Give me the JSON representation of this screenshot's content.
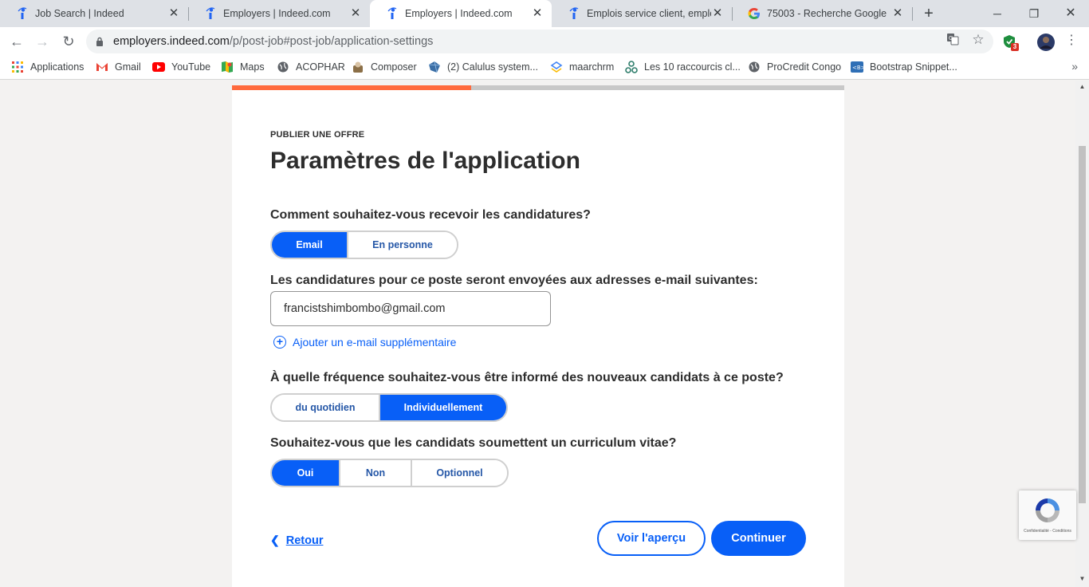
{
  "browser": {
    "tabs": [
      {
        "title": "Job Search | Indeed",
        "icon": "indeed-icon",
        "active": false
      },
      {
        "title": "Employers | Indeed.com",
        "icon": "indeed-icon",
        "active": false
      },
      {
        "title": "Employers | Indeed.com",
        "icon": "indeed-icon",
        "active": true
      },
      {
        "title": "Emplois service client, emploi |",
        "icon": "indeed-icon",
        "active": false
      },
      {
        "title": "75003 - Recherche Google",
        "icon": "google-icon",
        "active": false
      }
    ],
    "url_host": "employers.indeed.com",
    "url_path": "/p/post-job#post-job/application-settings",
    "extension_badge": "3",
    "bookmarks": [
      {
        "label": "Applications",
        "icon": "apps-grid-icon"
      },
      {
        "label": "Gmail",
        "icon": "gmail-icon"
      },
      {
        "label": "YouTube",
        "icon": "youtube-icon"
      },
      {
        "label": "Maps",
        "icon": "maps-icon"
      },
      {
        "label": "ACOPHAR",
        "icon": "globe-icon"
      },
      {
        "label": "Composer",
        "icon": "composer-icon"
      },
      {
        "label": "(2) Calulus system...",
        "icon": "calulus-icon"
      },
      {
        "label": "maarchrm",
        "icon": "maarch-icon"
      },
      {
        "label": "Les 10 raccourcis cl...",
        "icon": "raccourcis-icon"
      },
      {
        "label": "ProCredit Congo",
        "icon": "globe-icon"
      },
      {
        "label": "Bootstrap Snippet...",
        "icon": "bootstrap-icon"
      }
    ],
    "more_label": "»"
  },
  "page": {
    "progress_fraction": 0.39,
    "eyebrow": "PUBLIER UNE OFFRE",
    "title": "Paramètres de l'application",
    "q1": {
      "label": "Comment souhaitez-vous recevoir les candidatures?",
      "options": [
        "Email",
        "En personne"
      ],
      "selected": "Email"
    },
    "q2": {
      "label": "Les candidatures pour ce poste seront envoyées aux adresses e-mail suivantes:",
      "email_value": "francistshimbombo@gmail.com",
      "add_email_label": "Ajouter un e-mail supplémentaire"
    },
    "q3": {
      "label": "À quelle fréquence souhaitez-vous être informé des nouveaux candidats à ce poste?",
      "options": [
        "du quotidien",
        "Individuellement"
      ],
      "selected": "Individuellement"
    },
    "q4": {
      "label": "Souhaitez-vous que les candidats soumettent un curriculum vitae?",
      "options": [
        "Oui",
        "Non",
        "Optionnel"
      ],
      "selected": "Oui"
    },
    "back_label": "Retour",
    "preview_label": "Voir l'aperçu",
    "continue_label": "Continuer",
    "recaptcha_text": "Confidentialité - Conditions"
  },
  "colors": {
    "primary": "#085ff7",
    "progress": "#ff6a3d"
  }
}
